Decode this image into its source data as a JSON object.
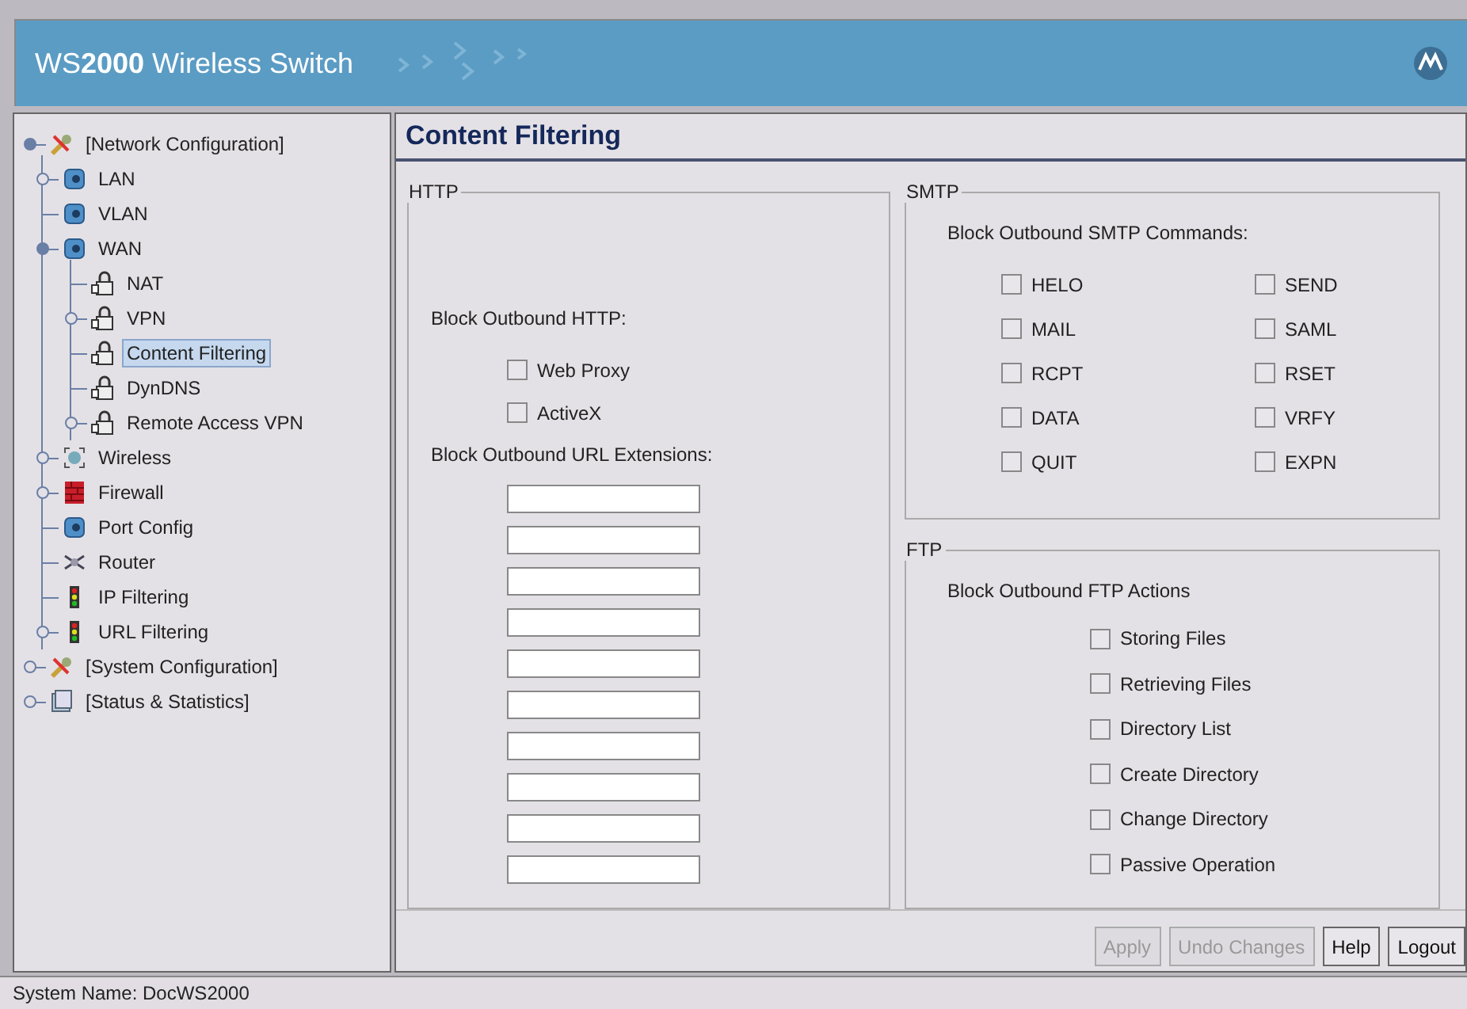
{
  "header": {
    "title": "WS**2000** Wireless Switch"
  },
  "tree": [
    {
      "label": "[Network Configuration]",
      "kind": "tools",
      "selected": false,
      "expanded": true,
      "children": [
        {
          "label": "LAN",
          "kind": "network",
          "selected": false,
          "expanded": false
        },
        {
          "label": "VLAN",
          "kind": "network",
          "selected": false
        },
        {
          "label": "WAN",
          "kind": "network",
          "selected": false,
          "expanded": true,
          "children": [
            {
              "label": "NAT",
              "kind": "lock",
              "selected": false
            },
            {
              "label": "VPN",
              "kind": "lock",
              "selected": false,
              "expanded": false
            },
            {
              "label": "Content Filtering",
              "kind": "lock",
              "selected": true
            },
            {
              "label": "DynDNS",
              "kind": "lock",
              "selected": false
            },
            {
              "label": "Remote Access VPN",
              "kind": "lock",
              "selected": false,
              "expanded": false
            }
          ]
        },
        {
          "label": "Wireless",
          "kind": "wireless",
          "selected": false,
          "expanded": false
        },
        {
          "label": "Firewall",
          "kind": "firewall",
          "selected": false,
          "expanded": false
        },
        {
          "label": "Port Config",
          "kind": "network",
          "selected": false
        },
        {
          "label": "Router",
          "kind": "router",
          "selected": false
        },
        {
          "label": "IP Filtering",
          "kind": "traffic",
          "selected": false
        },
        {
          "label": "URL Filtering",
          "kind": "traffic",
          "selected": false,
          "expanded": false
        }
      ]
    },
    {
      "label": "[System Configuration]",
      "kind": "tools",
      "selected": false,
      "expanded": false
    },
    {
      "label": "[Status & Statistics]",
      "kind": "folder",
      "selected": false,
      "expanded": false
    }
  ],
  "page_title": "Content Filtering",
  "http": {
    "legend": "HTTP",
    "block_label": "Block Outbound HTTP:",
    "options": [
      {
        "label": "Web Proxy",
        "checked": false
      },
      {
        "label": "ActiveX",
        "checked": false
      }
    ],
    "url_label": "Block Outbound URL Extensions:",
    "url_extensions": [
      {
        "kind": "input"
      },
      {
        "kind": "input"
      },
      {
        "kind": "input"
      },
      {
        "kind": "input"
      },
      {
        "kind": "input"
      },
      {
        "kind": "input"
      },
      {
        "kind": "input"
      },
      {
        "kind": "input"
      },
      {
        "kind": "input"
      },
      {
        "kind": "input"
      }
    ]
  },
  "smtp": {
    "legend": "SMTP",
    "block_label": "Block Outbound SMTP Commands:",
    "commands": [
      {
        "label": "HELO",
        "checked": false
      },
      {
        "label": "SEND",
        "checked": false
      },
      {
        "label": "MAIL",
        "checked": false
      },
      {
        "label": "SAML",
        "checked": false
      },
      {
        "label": "RCPT",
        "checked": false
      },
      {
        "label": "RSET",
        "checked": false
      },
      {
        "label": "DATA",
        "checked": false
      },
      {
        "label": "VRFY",
        "checked": false
      },
      {
        "label": "QUIT",
        "checked": false
      },
      {
        "label": "EXPN",
        "checked": false
      }
    ]
  },
  "ftp": {
    "legend": "FTP",
    "block_label": "Block Outbound FTP Actions",
    "actions": [
      {
        "label": "Storing Files",
        "checked": false
      },
      {
        "label": "Retrieving Files",
        "checked": false
      },
      {
        "label": "Directory List",
        "checked": false
      },
      {
        "label": "Create Directory",
        "checked": false
      },
      {
        "label": "Change Directory",
        "checked": false
      },
      {
        "label": "Passive Operation",
        "checked": false
      }
    ]
  },
  "buttons": [
    {
      "label": "Apply",
      "disabled": true
    },
    {
      "label": "Undo Changes",
      "disabled": true
    },
    {
      "label": "Help",
      "disabled": false
    },
    {
      "label": "Logout",
      "disabled": false
    }
  ],
  "status_bar": "System Name: DocWS2000"
}
